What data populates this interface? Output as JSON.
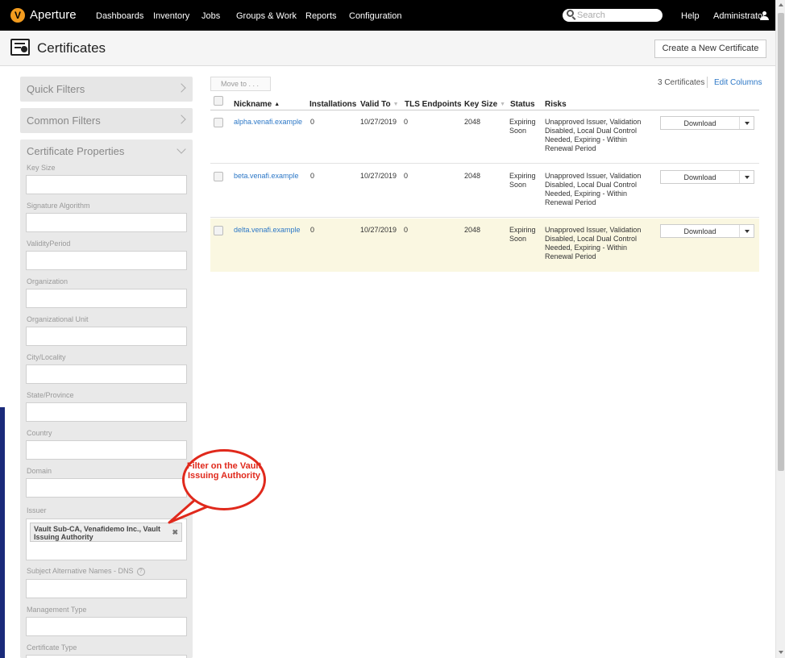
{
  "nav": {
    "logo_letter": "V",
    "app_name": "Aperture",
    "items": [
      "Dashboards",
      "Inventory",
      "Jobs",
      "Groups & Work",
      "Reports",
      "Configuration"
    ],
    "search_placeholder": "Search",
    "help": "Help",
    "user": "Administrator"
  },
  "header": {
    "title": "Certificates",
    "create_button": "Create a New Certificate"
  },
  "sidebar": {
    "quick_filters": "Quick Filters",
    "common_filters": "Common Filters",
    "properties_title": "Certificate Properties",
    "fields": [
      "Key Size",
      "Signature Algorithm",
      "ValidityPeriod",
      "Organization",
      "Organizational Unit",
      "City/Locality",
      "State/Province",
      "Country",
      "Domain",
      "Issuer",
      "Subject Alternative Names - DNS",
      "Management Type",
      "Certificate Type"
    ],
    "issuer_tag": "Vault Sub-CA, Venafidemo Inc., Vault Issuing Authority",
    "help_glyph": "?"
  },
  "callout": {
    "text": "Filter on the Vault Issuing Authority",
    "color": "#e0291c"
  },
  "toolbar": {
    "move_to": "Move to . . .",
    "count": "3 Certificates",
    "edit_columns": "Edit Columns"
  },
  "table": {
    "columns": [
      "Nickname",
      "Installations",
      "Valid To",
      "TLS Endpoints",
      "Key Size",
      "Status",
      "Risks"
    ],
    "rows": [
      {
        "nickname": "alpha.venafi.example",
        "installations": "0",
        "valid_to": "10/27/2019",
        "tls": "0",
        "key_size": "2048",
        "status": "Expiring Soon",
        "risks": "Unapproved Issuer, Validation Disabled, Local Dual Control Needed, Expiring - Within Renewal Period",
        "action": "Download"
      },
      {
        "nickname": "beta.venafi.example",
        "installations": "0",
        "valid_to": "10/27/2019",
        "tls": "0",
        "key_size": "2048",
        "status": "Expiring Soon",
        "risks": "Unapproved Issuer, Validation Disabled, Local Dual Control Needed, Expiring - Within Renewal Period",
        "action": "Download"
      },
      {
        "nickname": "delta.venafi.example",
        "installations": "0",
        "valid_to": "10/27/2019",
        "tls": "0",
        "key_size": "2048",
        "status": "Expiring Soon",
        "risks": "Unapproved Issuer, Validation Disabled, Local Dual Control Needed, Expiring - Within Renewal Period",
        "action": "Download"
      }
    ]
  },
  "colors": {
    "accent": "#f39c1f",
    "link": "#2d78c7",
    "highlight_row": "#faf7e1"
  }
}
